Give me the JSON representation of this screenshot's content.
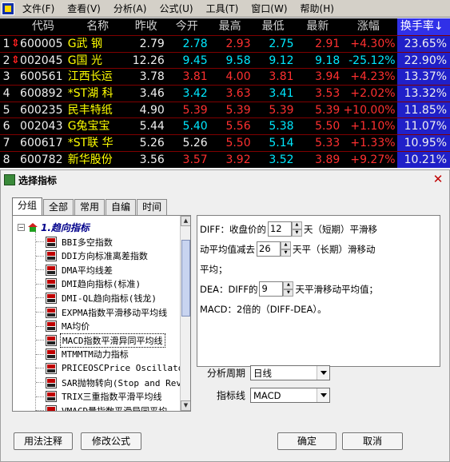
{
  "menu": [
    "文件(F)",
    "查看(V)",
    "分析(A)",
    "公式(U)",
    "工具(T)",
    "窗口(W)",
    "帮助(H)"
  ],
  "table": {
    "headers": [
      "代码",
      "名称",
      "昨收",
      "今开",
      "最高",
      "最低",
      "最新",
      "涨幅",
      "换手率↓"
    ],
    "rows": [
      {
        "n": "1",
        "mk": "⇕",
        "code": "600005",
        "name": "G武 钢",
        "prev": "2.79",
        "open": "2.78",
        "high": "2.93",
        "low": "2.75",
        "last": "2.91",
        "chg": "+4.30%",
        "turn": "23.65%",
        "oc": "green",
        "hc": "red",
        "lc": "green",
        "tc": "red",
        "cc": "red"
      },
      {
        "n": "2",
        "mk": "⇕",
        "code": "002045",
        "name": "G国 光",
        "prev": "12.26",
        "open": "9.45",
        "high": "9.58",
        "low": "9.12",
        "last": "9.18",
        "chg": "-25.12%",
        "turn": "22.90%",
        "oc": "green",
        "hc": "green",
        "lc": "green",
        "tc": "green",
        "cc": "green"
      },
      {
        "n": "3",
        "mk": "",
        "code": "600561",
        "name": "江西长运",
        "prev": "3.78",
        "open": "3.81",
        "high": "4.00",
        "low": "3.81",
        "last": "3.94",
        "chg": "+4.23%",
        "turn": "13.37%",
        "oc": "red",
        "hc": "red",
        "lc": "red",
        "tc": "red",
        "cc": "red"
      },
      {
        "n": "4",
        "mk": "",
        "code": "600892",
        "name": "*ST湖 科",
        "prev": "3.46",
        "open": "3.42",
        "high": "3.63",
        "low": "3.41",
        "last": "3.53",
        "chg": "+2.02%",
        "turn": "13.32%",
        "oc": "green",
        "hc": "red",
        "lc": "green",
        "tc": "red",
        "cc": "red"
      },
      {
        "n": "5",
        "mk": "",
        "code": "600235",
        "name": "民丰特纸",
        "prev": "4.90",
        "open": "5.39",
        "high": "5.39",
        "low": "5.39",
        "last": "5.39",
        "chg": "+10.00%",
        "turn": "11.85%",
        "oc": "red",
        "hc": "red",
        "lc": "red",
        "tc": "red",
        "cc": "red"
      },
      {
        "n": "6",
        "mk": "",
        "code": "002043",
        "name": "G兔宝宝",
        "prev": "5.44",
        "open": "5.40",
        "high": "5.56",
        "low": "5.38",
        "last": "5.50",
        "chg": "+1.10%",
        "turn": "11.07%",
        "oc": "green",
        "hc": "red",
        "lc": "green",
        "tc": "red",
        "cc": "red"
      },
      {
        "n": "7",
        "mk": "",
        "code": "600617",
        "name": "*ST联 华",
        "prev": "5.26",
        "open": "5.26",
        "high": "5.50",
        "low": "5.14",
        "last": "5.33",
        "chg": "+1.33%",
        "turn": "10.95%",
        "oc": "white",
        "hc": "red",
        "lc": "green",
        "tc": "red",
        "cc": "red"
      },
      {
        "n": "8",
        "mk": "",
        "code": "600782",
        "name": "新华股份",
        "prev": "3.56",
        "open": "3.57",
        "high": "3.92",
        "low": "3.52",
        "last": "3.89",
        "chg": "+9.27%",
        "turn": "10.21%",
        "oc": "red",
        "hc": "red",
        "lc": "green",
        "tc": "red",
        "cc": "red"
      }
    ]
  },
  "dialog": {
    "title": "选择指标",
    "close": "✕",
    "tabs": [
      "分组",
      "全部",
      "常用",
      "自编",
      "时间"
    ],
    "tree_root": "1.趋向指标",
    "tree_items": [
      "BBI多空指数",
      "DDI方向标准离差指数",
      "DMA平均线差",
      "DMI趋向指标(标准)",
      "DMI-QL趋向指标(钱龙)",
      "EXPMA指数平滑移动平均线",
      "MA均价",
      "MACD指数平滑异同平均线",
      "MTMMTM动力指标",
      "PRICEOSCPrice Oscillator",
      "SAR抛物转向(Stop and Rev",
      "TRIX三重指数平滑平均线",
      "VMACD量指数平滑异同平均"
    ],
    "selected_index": 7,
    "desc": {
      "l1a": "DIFF：收盘价的",
      "p1": "12",
      "l1b": "天（短期）平滑移",
      "l2a": "动平均值减去",
      "p2": "26",
      "l2b": "天平（长期）滑移动",
      "l3": "平均；",
      "l4a": "DEA：DIFF的",
      "p3": "9",
      "l4b": "天平滑移动平均值；",
      "l5": "MACD：2倍的（DIFF-DEA）。"
    },
    "period_label": "分析周期",
    "period_value": "日线",
    "line_label": "指标线",
    "line_value": "MACD",
    "buttons": {
      "usage": "用法注释",
      "edit": "修改公式",
      "ok": "确定",
      "cancel": "取消"
    }
  }
}
